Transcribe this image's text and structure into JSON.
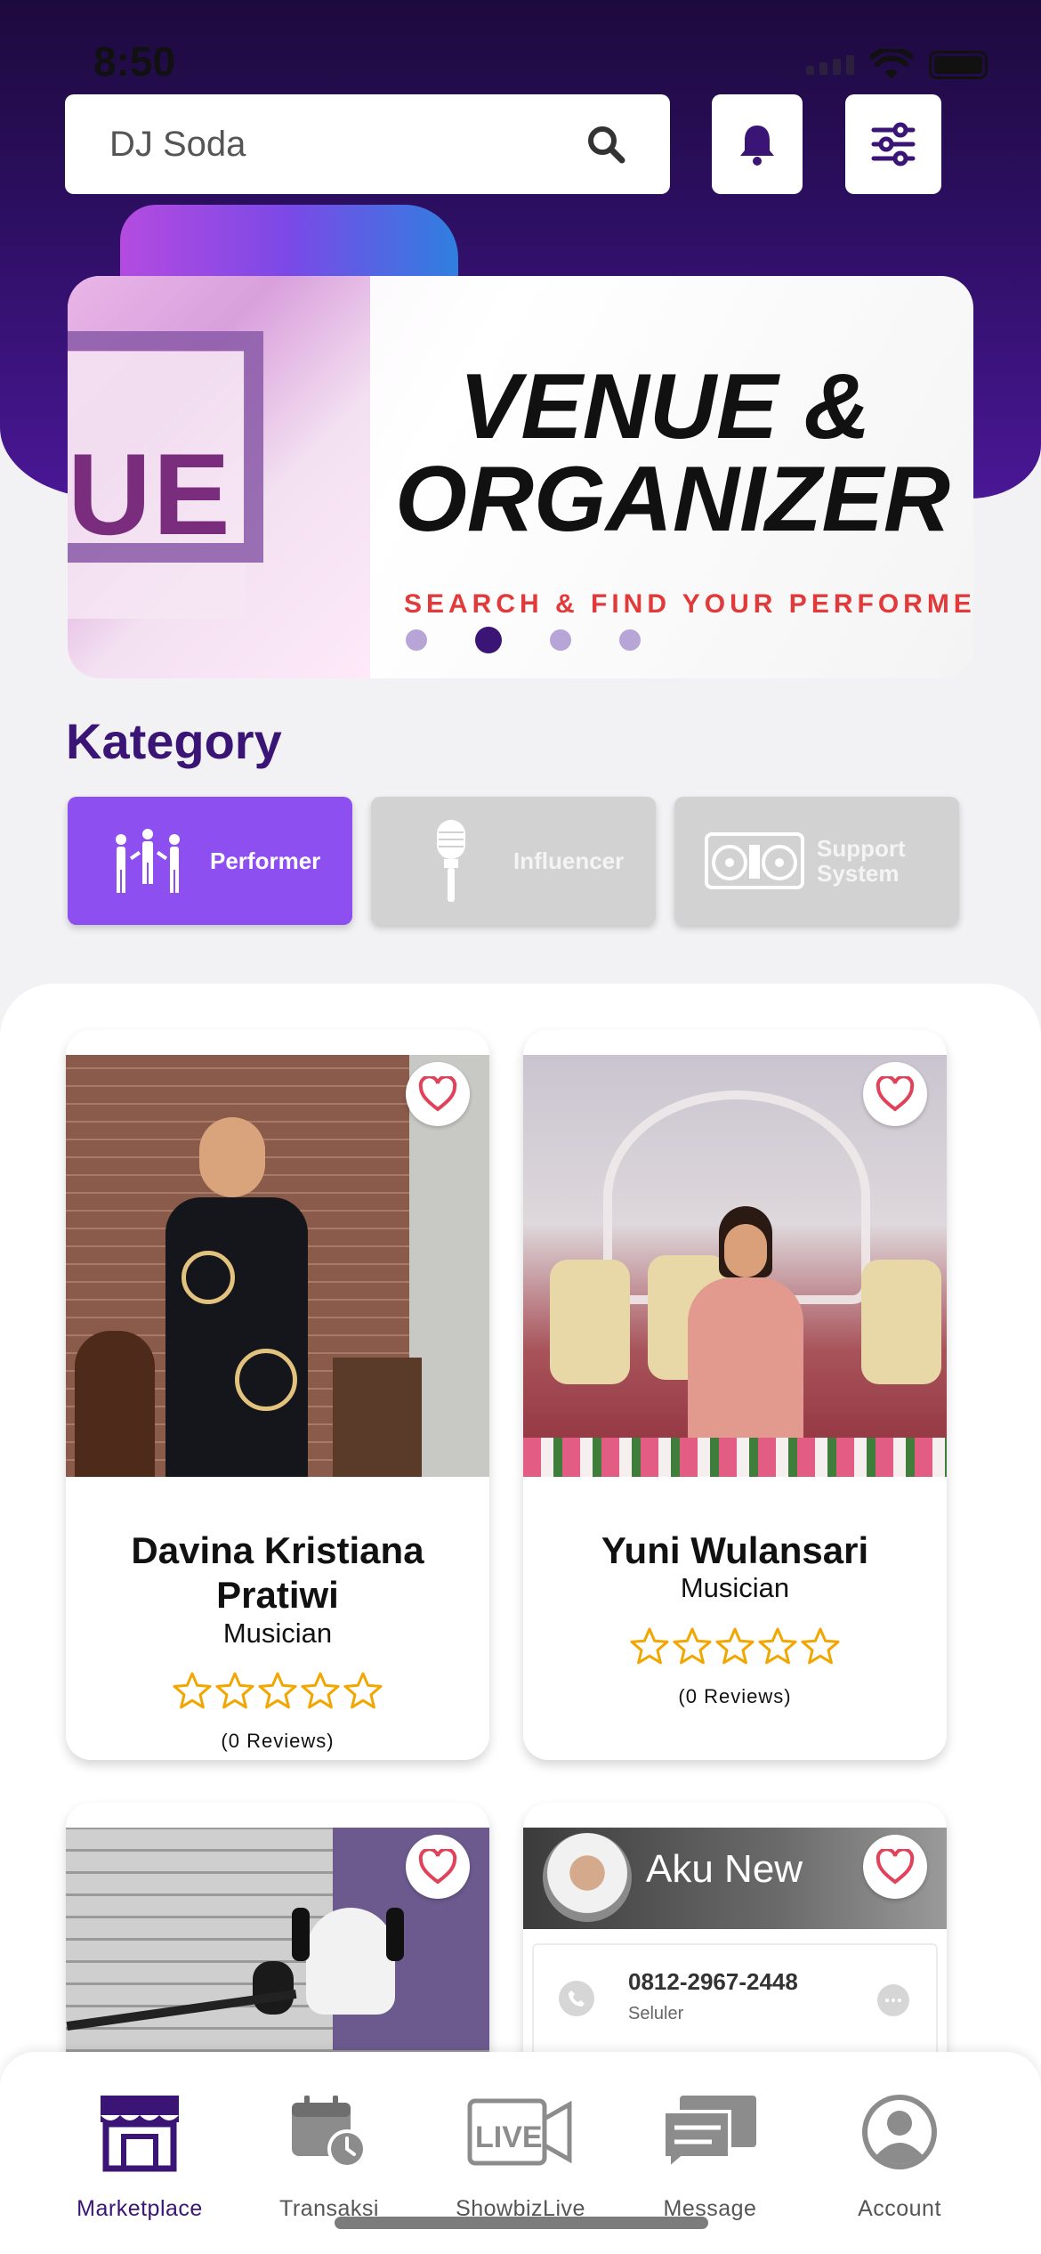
{
  "status_bar": {
    "time": "8:50"
  },
  "search": {
    "value": "DJ Soda"
  },
  "banner": {
    "title_line1": "VENUE &",
    "title_line2": "ORGANIZER",
    "subtitle": "SEARCH & FIND YOUR PERFORMER",
    "art_letters": "UE",
    "carousel_active_index": 1,
    "carousel_count": 4
  },
  "category": {
    "title": "Kategory",
    "items": [
      {
        "label": "Performer",
        "active": true
      },
      {
        "label": "Influencer",
        "active": false
      },
      {
        "label_line1": "Support",
        "label_line2": "System",
        "active": false
      }
    ]
  },
  "performers": [
    {
      "name": "Davina Kristiana Pratiwi",
      "role": "Musician",
      "rating": 0,
      "reviews": "(0 Reviews)"
    },
    {
      "name": "Yuni Wulansari",
      "role": "Musician",
      "rating": 0,
      "reviews": "(0 Reviews)"
    },
    {
      "name": "",
      "role": "",
      "rating": 0,
      "reviews": ""
    },
    {
      "photo_caption": "Aku New",
      "phone": "0812-2967-2448",
      "phone_type": "Seluler"
    }
  ],
  "tabs": [
    {
      "label": "Marketplace",
      "active": true
    },
    {
      "label": "Transaksi",
      "active": false
    },
    {
      "label": "ShowbizLive",
      "active": false
    },
    {
      "label": "Message",
      "active": false
    },
    {
      "label": "Account",
      "active": false
    }
  ],
  "colors": {
    "brand_dark": "#3a1576",
    "brand_accent": "#8e4ff0",
    "star": "#f2a600",
    "heart": "#e2415a"
  }
}
